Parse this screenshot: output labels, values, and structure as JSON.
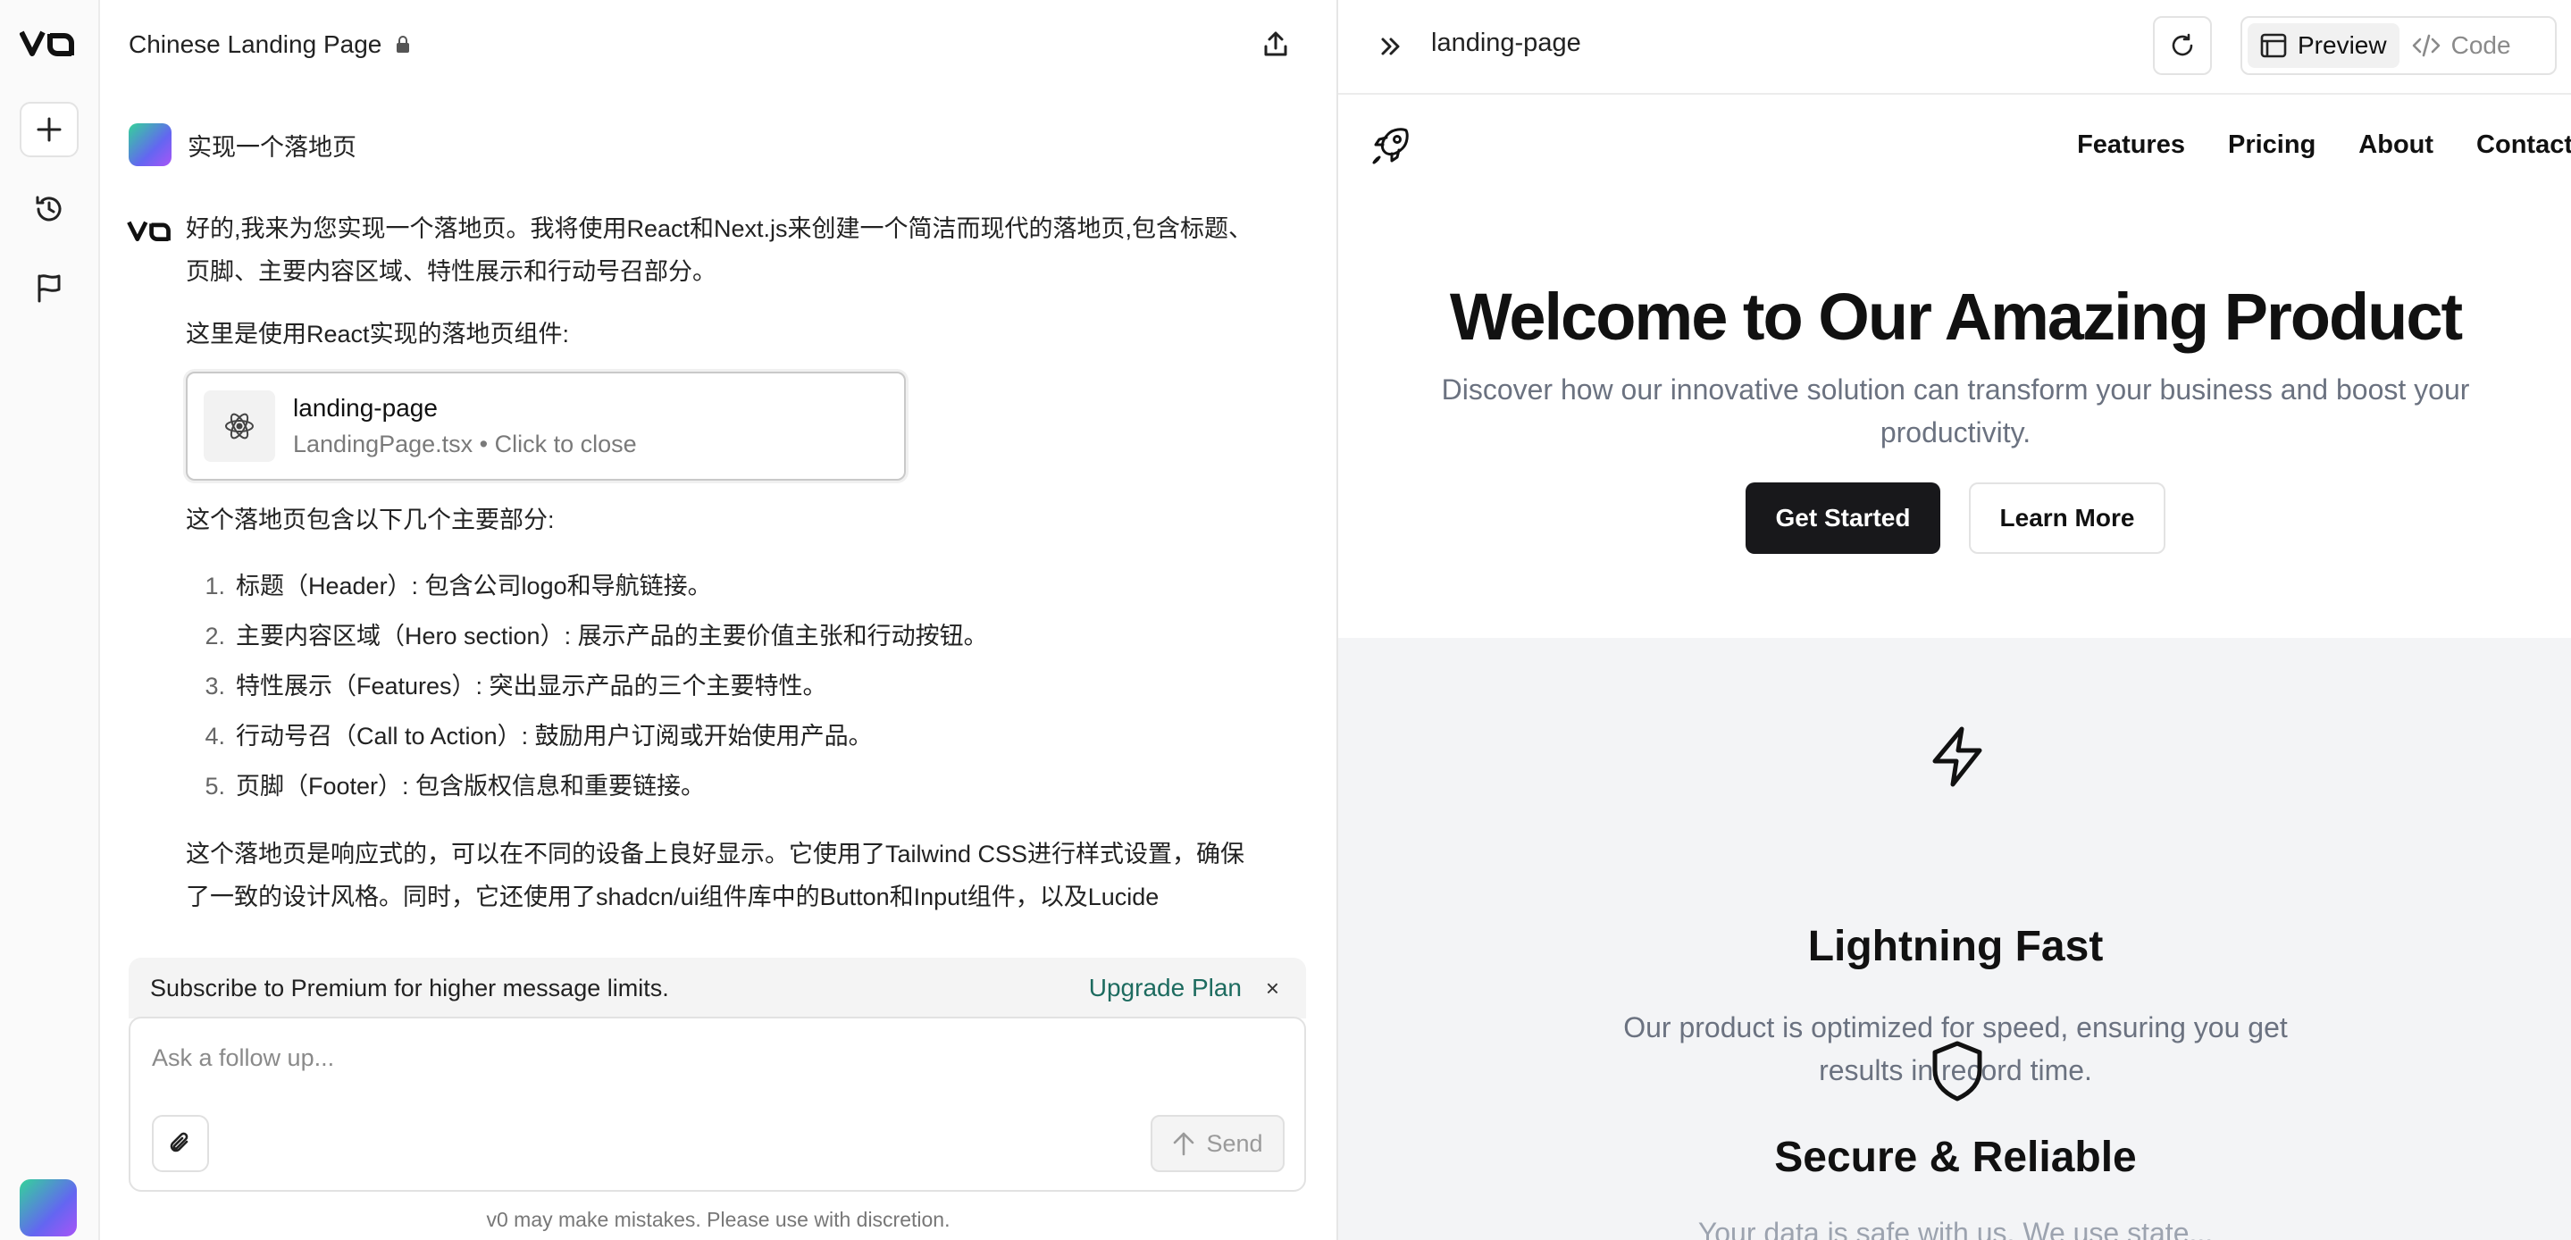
{
  "rail": {
    "logo": "v0",
    "new_chat_icon": "plus-icon",
    "history_icon": "history-icon",
    "flag_icon": "flag-icon"
  },
  "chat": {
    "title": "Chinese Landing Page",
    "user_message": "实现一个落地页",
    "assistant": {
      "intro": "好的,我来为您实现一个落地页。我将使用React和Next.js来创建一个简洁而现代的落地页,包含标题、页脚、主要内容区域、特性展示和行动号召部分。",
      "component_note": "这里是使用React实现的落地页组件:",
      "file_card": {
        "name": "landing-page",
        "subtitle": "LandingPage.tsx • Click to close"
      },
      "list_intro": "这个落地页包含以下几个主要部分:",
      "sections": [
        {
          "num": "1.",
          "text": "标题（Header）: 包含公司logo和导航链接。"
        },
        {
          "num": "2.",
          "text": "主要内容区域（Hero section）: 展示产品的主要价值主张和行动按钮。"
        },
        {
          "num": "3.",
          "text": "特性展示（Features）: 突出显示产品的三个主要特性。"
        },
        {
          "num": "4.",
          "text": "行动号召（Call to Action）: 鼓励用户订阅或开始使用产品。"
        },
        {
          "num": "5.",
          "text": "页脚（Footer）: 包含版权信息和重要链接。"
        }
      ],
      "outro": "这个落地页是响应式的，可以在不同的设备上良好显示。它使用了Tailwind CSS进行样式设置，确保了一致的设计风格。同时，它还使用了shadcn/ui组件库中的Button和Input组件，以及Lucide"
    },
    "banner": {
      "text": "Subscribe to Premium for higher message limits.",
      "upgrade": "Upgrade Plan",
      "close": "×"
    },
    "composer": {
      "placeholder": "Ask a follow up...",
      "send": "Send"
    },
    "disclaimer": "v0 may make mistakes. Please use with discretion."
  },
  "preview": {
    "title": "landing-page",
    "tabs": {
      "preview": "Preview",
      "code": "Code"
    },
    "site": {
      "nav": [
        "Features",
        "Pricing",
        "About",
        "Contact"
      ],
      "hero_title": "Welcome to Our Amazing Product",
      "hero_subtitle": "Discover how our innovative solution can transform your business and boost your productivity.",
      "primary_button": "Get Started",
      "secondary_button": "Learn More",
      "features": [
        {
          "icon": "zap-icon",
          "title": "Lightning Fast",
          "description": "Our product is optimized for speed, ensuring you get results in record time."
        },
        {
          "icon": "shield-icon",
          "title": "Secure & Reliable",
          "description": "Your data is safe with us. We use state..."
        }
      ]
    }
  }
}
